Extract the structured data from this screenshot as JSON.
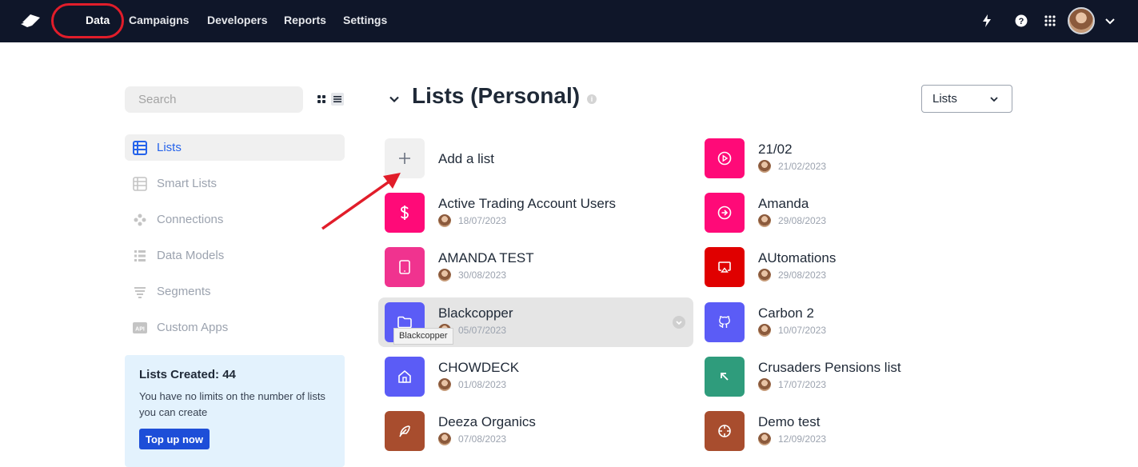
{
  "nav": {
    "items": [
      "Data",
      "Campaigns",
      "Developers",
      "Reports",
      "Settings"
    ],
    "active": "Data",
    "right_icons": [
      "bolt-icon",
      "help-icon",
      "apps-grid-icon"
    ]
  },
  "sidebar": {
    "search_placeholder": "Search",
    "items": [
      {
        "label": "Lists",
        "icon": "table-icon",
        "active": true
      },
      {
        "label": "Smart Lists",
        "icon": "table-icon",
        "active": false
      },
      {
        "label": "Connections",
        "icon": "connections-icon",
        "active": false
      },
      {
        "label": "Data Models",
        "icon": "data-models-icon",
        "active": false
      },
      {
        "label": "Segments",
        "icon": "segments-icon",
        "active": false
      },
      {
        "label": "Custom Apps",
        "icon": "api-icon",
        "active": false
      }
    ],
    "card": {
      "title": "Lists Created: 44",
      "description": "You have no limits on the number of lists you can create",
      "button": "Top up now"
    }
  },
  "main": {
    "title": "Lists (Personal)",
    "type_select": "Lists",
    "add_label": "Add a list",
    "tooltip": "Blackcopper",
    "lists_left": [
      {
        "name": "Active Trading Account Users",
        "date": "18/07/2023",
        "color": "#ff0a78",
        "icon": "dollar-icon"
      },
      {
        "name": "AMANDA TEST",
        "date": "30/08/2023",
        "color": "#f0338f",
        "icon": "tablet-icon"
      },
      {
        "name": "Blackcopper",
        "date": "05/07/2023",
        "color": "#5b5cf6",
        "icon": "folder-icon"
      },
      {
        "name": "CHOWDECK",
        "date": "01/08/2023",
        "color": "#5b5cf6",
        "icon": "home-icon"
      },
      {
        "name": "Deeza Organics",
        "date": "07/08/2023",
        "color": "#a84d2e",
        "icon": "feather-icon"
      }
    ],
    "lists_right": [
      {
        "name": "21/02",
        "date": "21/02/2023",
        "color": "#ff0a78",
        "icon": "play-icon"
      },
      {
        "name": "Amanda",
        "date": "29/08/2023",
        "color": "#ff0a78",
        "icon": "arrow-right-circle-icon"
      },
      {
        "name": "AUtomations",
        "date": "29/08/2023",
        "color": "#e00000",
        "icon": "airplay-icon"
      },
      {
        "name": "Carbon 2",
        "date": "10/07/2023",
        "color": "#5b5cf6",
        "icon": "github-icon"
      },
      {
        "name": "Crusaders Pensions list",
        "date": "17/07/2023",
        "color": "#2f9c7c",
        "icon": "arrow-up-left-icon"
      },
      {
        "name": "Demo test",
        "date": "12/09/2023",
        "color": "#a84d2e",
        "icon": "crosshair-icon"
      }
    ]
  }
}
